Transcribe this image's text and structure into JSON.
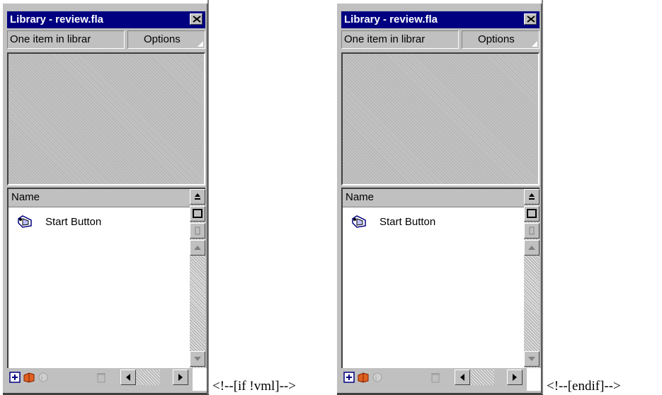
{
  "panels": [
    {
      "title": "Library - review.fla",
      "item_count": "One item in librar",
      "options_label": "Options",
      "column_header": "Name",
      "items": [
        {
          "label": "Start Button",
          "icon": "button-symbol-icon"
        }
      ],
      "bottom_icons": [
        "new-symbol-icon",
        "new-folder-icon",
        "properties-icon",
        "delete-icon"
      ]
    },
    {
      "title": "Library - review.fla",
      "item_count": "One item in librar",
      "options_label": "Options",
      "column_header": "Name",
      "items": [
        {
          "label": "Start Button",
          "icon": "button-symbol-icon"
        }
      ],
      "bottom_icons": [
        "new-symbol-icon",
        "new-folder-icon",
        "properties-icon",
        "delete-icon"
      ]
    }
  ],
  "comments": [
    "<!--[if !vml]-->",
    "<!--[endif]-->"
  ],
  "colors": {
    "titlebar": "#000080",
    "panel": "#c0c0c0"
  }
}
